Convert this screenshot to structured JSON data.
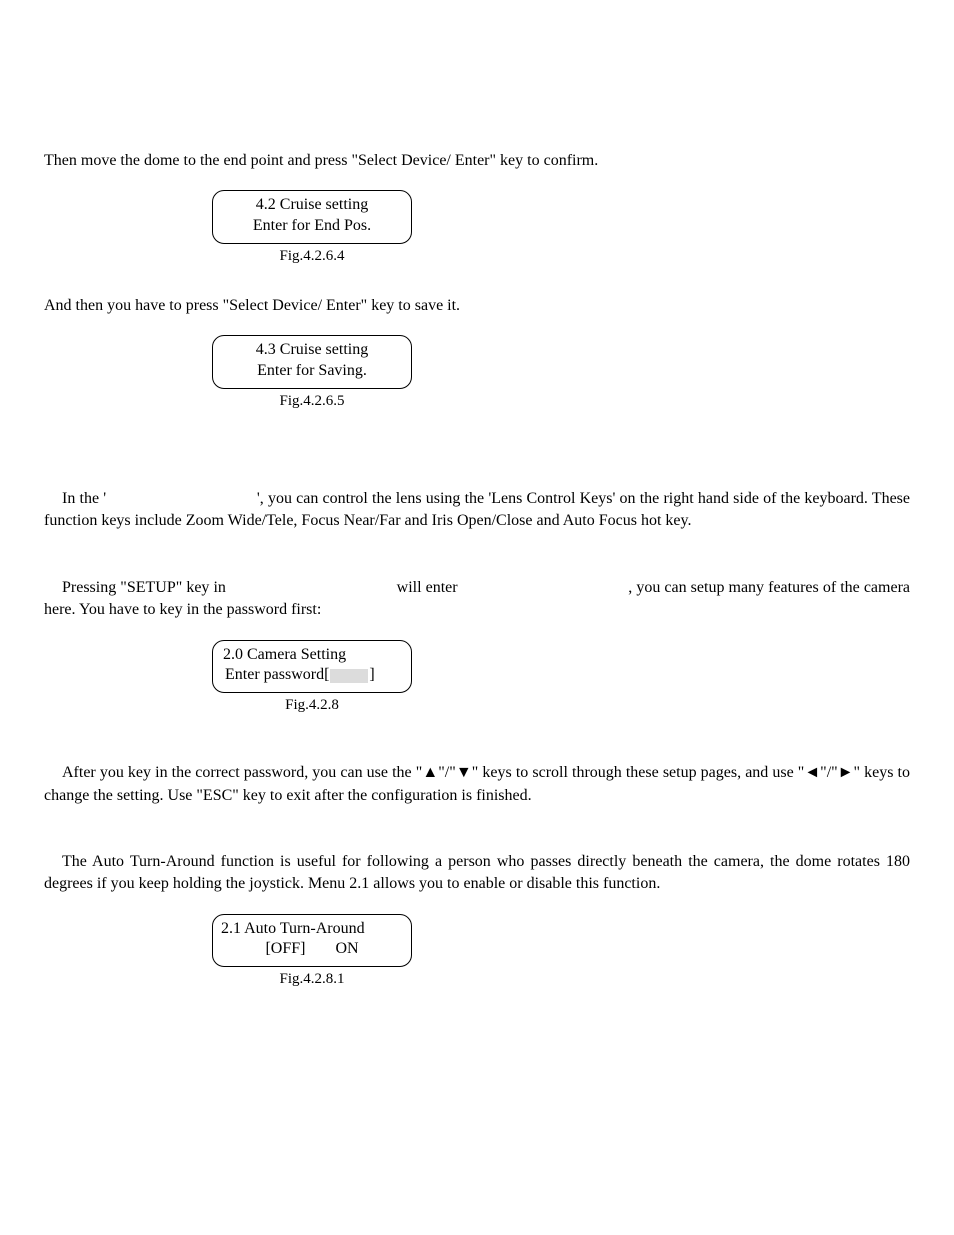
{
  "p1": "Then move the dome to the end point and press \"Select Device/ Enter\" key to confirm.",
  "lcd1": {
    "line1": "4.2 Cruise setting",
    "line2": "Enter for End Pos.",
    "caption": "Fig.4.2.6.4"
  },
  "p2": "And then you have to press \"Select Device/ Enter\" key to save it.",
  "lcd2": {
    "line1": "4.3 Cruise setting",
    "line2": "Enter for Saving.",
    "caption": "Fig.4.2.6.5"
  },
  "p3a": "In the '",
  "p3b": "', you can control the lens using the 'Lens Control Keys' on the right hand side of the keyboard. These function keys include Zoom Wide/Tele, Focus Near/Far and Iris Open/Close and Auto Focus hot key.",
  "gap3": "                                    ",
  "p4a": "Pressing \"SETUP\" key in ",
  "p4b": " will enter ",
  "p4c": ", you can setup many features of the camera here. You have to key in the password first:",
  "gap4a": "                                        ",
  "gap4b": "                                         ",
  "lcd3": {
    "line1": "2.0 Camera Setting",
    "line2a": "Enter password[",
    "line2b": "]",
    "caption": "Fig.4.2.8"
  },
  "p5": "After you key in the correct password, you can use the \"▲\"/\"▼\" keys to scroll through these setup pages, and use \"◄\"/\"►\" keys to change the setting. Use \"ESC\" key to exit after the configuration is finished.",
  "p6": "The Auto Turn-Around function is useful for following a person who passes directly beneath the camera, the dome rotates 180 degrees if you keep holding the joystick. Menu 2.1 allows you to enable or disable this function.",
  "lcd4": {
    "line1": "2.1 Auto Turn-Around",
    "opt1": "[OFF]",
    "opt2": "ON",
    "caption": "Fig.4.2.8.1"
  }
}
